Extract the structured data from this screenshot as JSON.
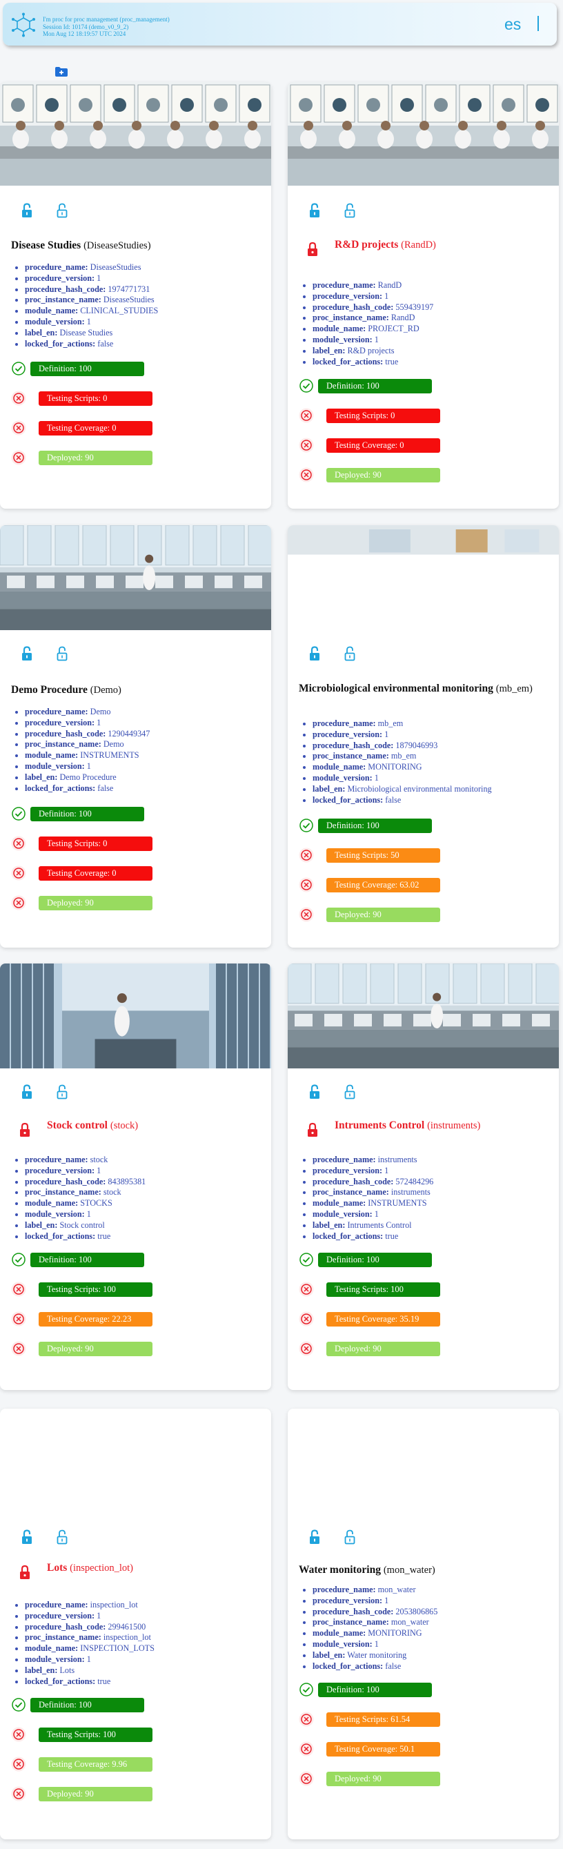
{
  "header": {
    "line1": "I'm proc for proc management (proc_management)",
    "line2": "Session Id: 10174 (demo_v0_9_2)",
    "line3": "Mon Aug 12 18:19:57 UTC 2024",
    "lang": "es"
  },
  "colors": {
    "accent": "#22a3dc",
    "ok": "#0b8a0b",
    "fail": "#f50d0d",
    "warn": "#fb8b14",
    "deployed": "#98db5f"
  },
  "field_labels": [
    "procedure_name:",
    "procedure_version:",
    "procedure_hash_code:",
    "proc_instance_name:",
    "module_name:",
    "module_version:",
    "label_en:",
    "locked_for_actions:"
  ],
  "cards": [
    {
      "title": "Disease Studies",
      "code": "(DiseaseStudies)",
      "fields": [
        "DiseaseStudies",
        "1",
        "1974771731",
        "DiseaseStudies",
        "CLINICAL_STUDIES",
        "1",
        "Disease Studies",
        "false"
      ],
      "status": [
        "Definition: 100",
        "Testing Scripts: 0",
        "Testing Coverage: 0",
        "Deployed: 90"
      ]
    },
    {
      "title": "R&D projects",
      "code": "(RandD)",
      "fields": [
        "RandD",
        "1",
        "559439197",
        "RandD",
        "PROJECT_RD",
        "1",
        "R&D projects",
        "true"
      ],
      "status": [
        "Definition: 100",
        "Testing Scripts: 0",
        "Testing Coverage: 0",
        "Deployed: 90"
      ]
    },
    {
      "title": "Demo Procedure",
      "code": "(Demo)",
      "fields": [
        "Demo",
        "1",
        "1290449347",
        "Demo",
        "INSTRUMENTS",
        "1",
        "Demo Procedure",
        "false"
      ],
      "status": [
        "Definition: 100",
        "Testing Scripts: 0",
        "Testing Coverage: 0",
        "Deployed: 90"
      ]
    },
    {
      "title": "Microbiological environmental monitoring",
      "code": "(mb_em)",
      "fields": [
        "mb_em",
        "1",
        "1879046993",
        "mb_em",
        "MONITORING",
        "1",
        "Microbiological environmental monitoring",
        "false"
      ],
      "status": [
        "Definition: 100",
        "Testing Scripts: 50",
        "Testing Coverage: 63.02",
        "Deployed: 90"
      ]
    },
    {
      "title": "Stock control",
      "code": "(stock)",
      "fields": [
        "stock",
        "1",
        "843895381",
        "stock",
        "STOCKS",
        "1",
        "Stock control",
        "true"
      ],
      "status": [
        "Definition: 100",
        "Testing Scripts: 100",
        "Testing Coverage: 22.23",
        "Deployed: 90"
      ]
    },
    {
      "title": "Intruments Control",
      "code": "(instruments)",
      "fields": [
        "instruments",
        "1",
        "572484296",
        "instruments",
        "INSTRUMENTS",
        "1",
        "Intruments Control",
        "true"
      ],
      "status": [
        "Definition: 100",
        "Testing Scripts: 100",
        "Testing Coverage: 35.19",
        "Deployed: 90"
      ]
    },
    {
      "title": "Lots",
      "code": "(inspection_lot)",
      "fields": [
        "inspection_lot",
        "1",
        "299461500",
        "inspection_lot",
        "INSPECTION_LOTS",
        "1",
        "Lots",
        "true"
      ],
      "status": [
        "Definition: 100",
        "Testing Scripts: 100",
        "Testing Coverage: 9.96",
        "Deployed: 90"
      ]
    },
    {
      "title": "Water monitoring",
      "code": "(mon_water)",
      "fields": [
        "mon_water",
        "1",
        "2053806865",
        "mon_water",
        "MONITORING",
        "1",
        "Water monitoring",
        "false"
      ],
      "status": [
        "Definition: 100",
        "Testing Scripts: 61.54",
        "Testing Coverage: 50.1",
        "Deployed: 90"
      ]
    }
  ]
}
